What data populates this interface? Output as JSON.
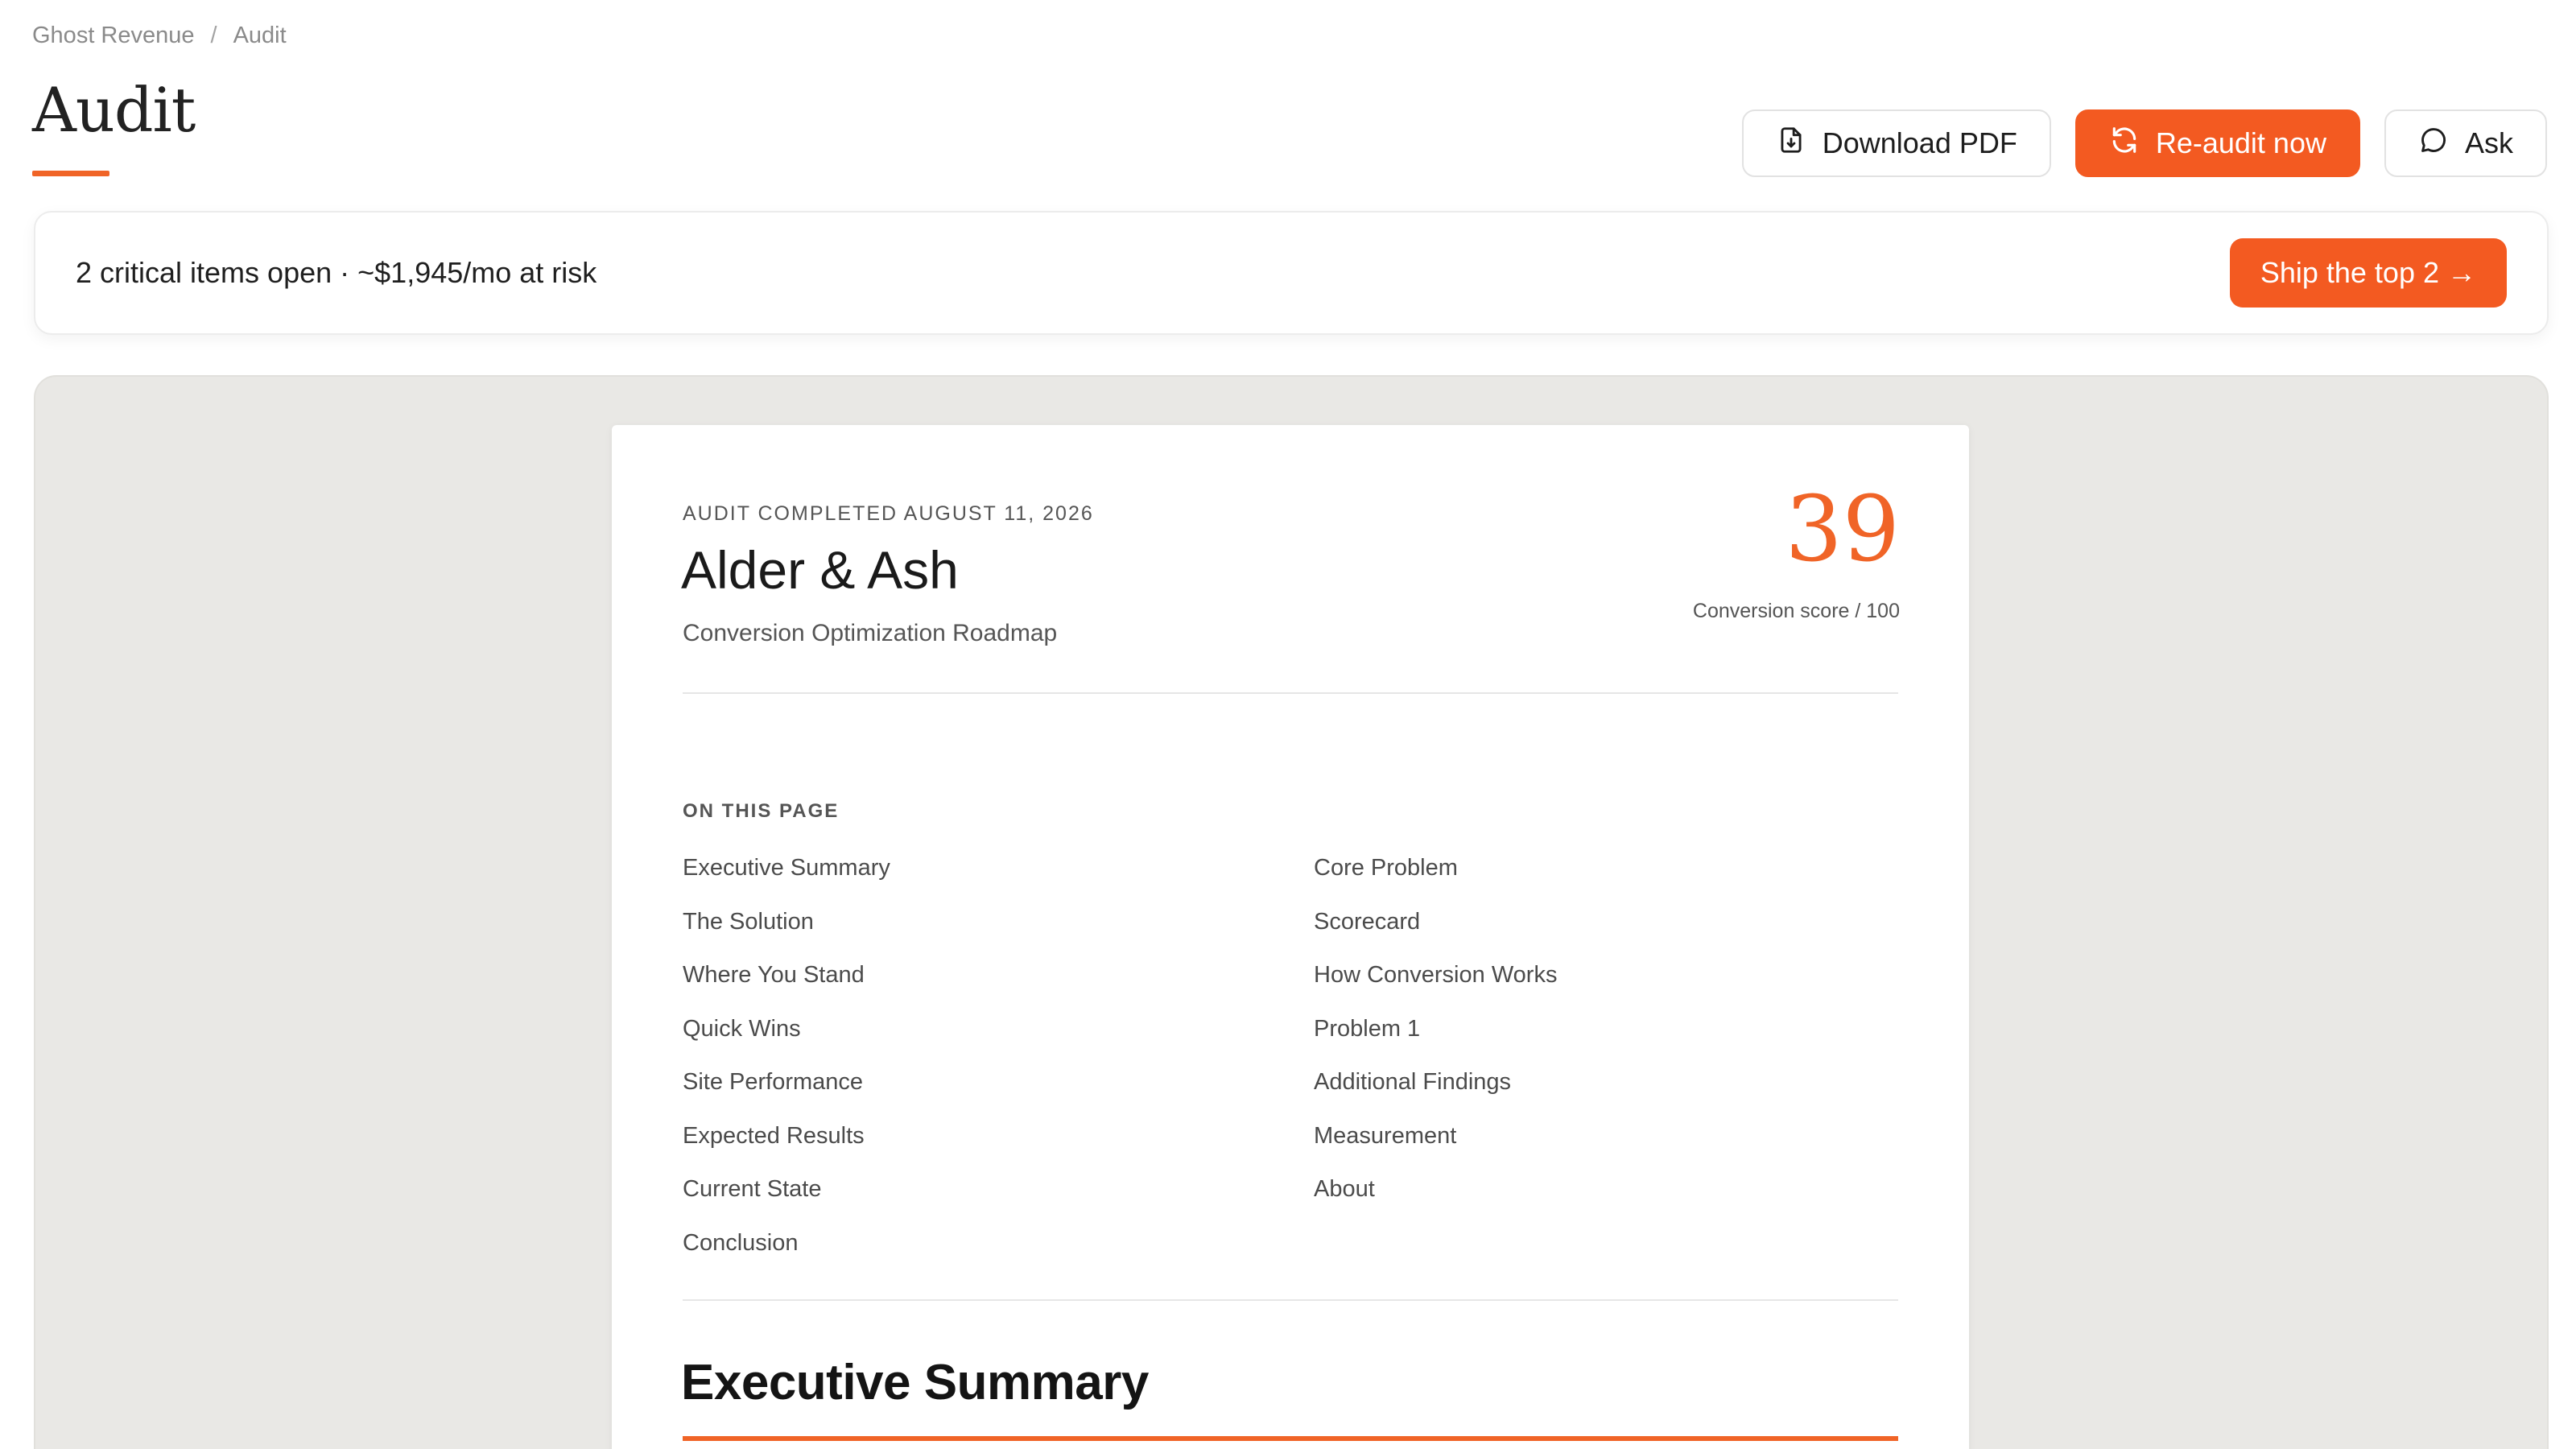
{
  "breadcrumb": {
    "root": "Ghost Revenue",
    "separator": "/",
    "current": "Audit"
  },
  "page": {
    "title": "Audit"
  },
  "actions": {
    "download_label": "Download PDF",
    "reaudit_label": "Re-audit now",
    "ask_label": "Ask"
  },
  "alert": {
    "text": "2 critical items open · ~$1,945/mo at risk",
    "cta_label": "Ship the top 2 →"
  },
  "document": {
    "eyebrow": "AUDIT COMPLETED AUGUST 11, 2026",
    "client": "Alder & Ash",
    "subtitle": "Conversion Optimization Roadmap",
    "score": "39",
    "score_caption": "Conversion score / 100",
    "toc_label": "ON THIS PAGE",
    "toc": [
      "Executive Summary",
      "Core Problem",
      "The Solution",
      "Scorecard",
      "Where You Stand",
      "How Conversion Works",
      "Quick Wins",
      "Problem 1",
      "Site Performance",
      "Additional Findings",
      "Expected Results",
      "Measurement",
      "Current State",
      "About",
      "Conclusion"
    ],
    "section_heading": "Executive Summary"
  },
  "colors": {
    "accent": "#f35a21",
    "score": "#f06427",
    "viewer_bg": "#e9e8e5"
  },
  "icons": {
    "download": "file-download-icon",
    "reaudit": "refresh-icon",
    "ask": "chat-bubble-icon"
  }
}
